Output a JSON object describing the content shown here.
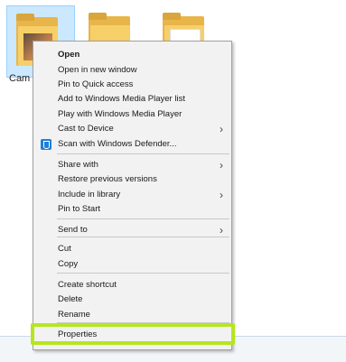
{
  "folders": [
    {
      "label": "Cam",
      "selected": true
    },
    {
      "label": "",
      "selected": false
    },
    {
      "label": "",
      "selected": false
    }
  ],
  "menu": {
    "groups": [
      [
        {
          "label": "Open",
          "bold": true
        },
        {
          "label": "Open in new window"
        },
        {
          "label": "Pin to Quick access"
        },
        {
          "label": "Add to Windows Media Player list"
        },
        {
          "label": "Play with Windows Media Player"
        },
        {
          "label": "Cast to Device",
          "submenu": true
        },
        {
          "label": "Scan with Windows Defender...",
          "icon": "shield-icon"
        }
      ],
      [
        {
          "label": "Share with",
          "submenu": true
        },
        {
          "label": "Restore previous versions"
        },
        {
          "label": "Include in library",
          "submenu": true
        },
        {
          "label": "Pin to Start"
        }
      ],
      [
        {
          "label": "Send to",
          "submenu": true
        }
      ],
      [
        {
          "label": "Cut"
        },
        {
          "label": "Copy"
        }
      ],
      [
        {
          "label": "Create shortcut"
        },
        {
          "label": "Delete"
        },
        {
          "label": "Rename"
        }
      ],
      [
        {
          "label": "Properties"
        }
      ]
    ],
    "submenu_arrow": "›"
  },
  "highlight_color": "#b5e61d"
}
